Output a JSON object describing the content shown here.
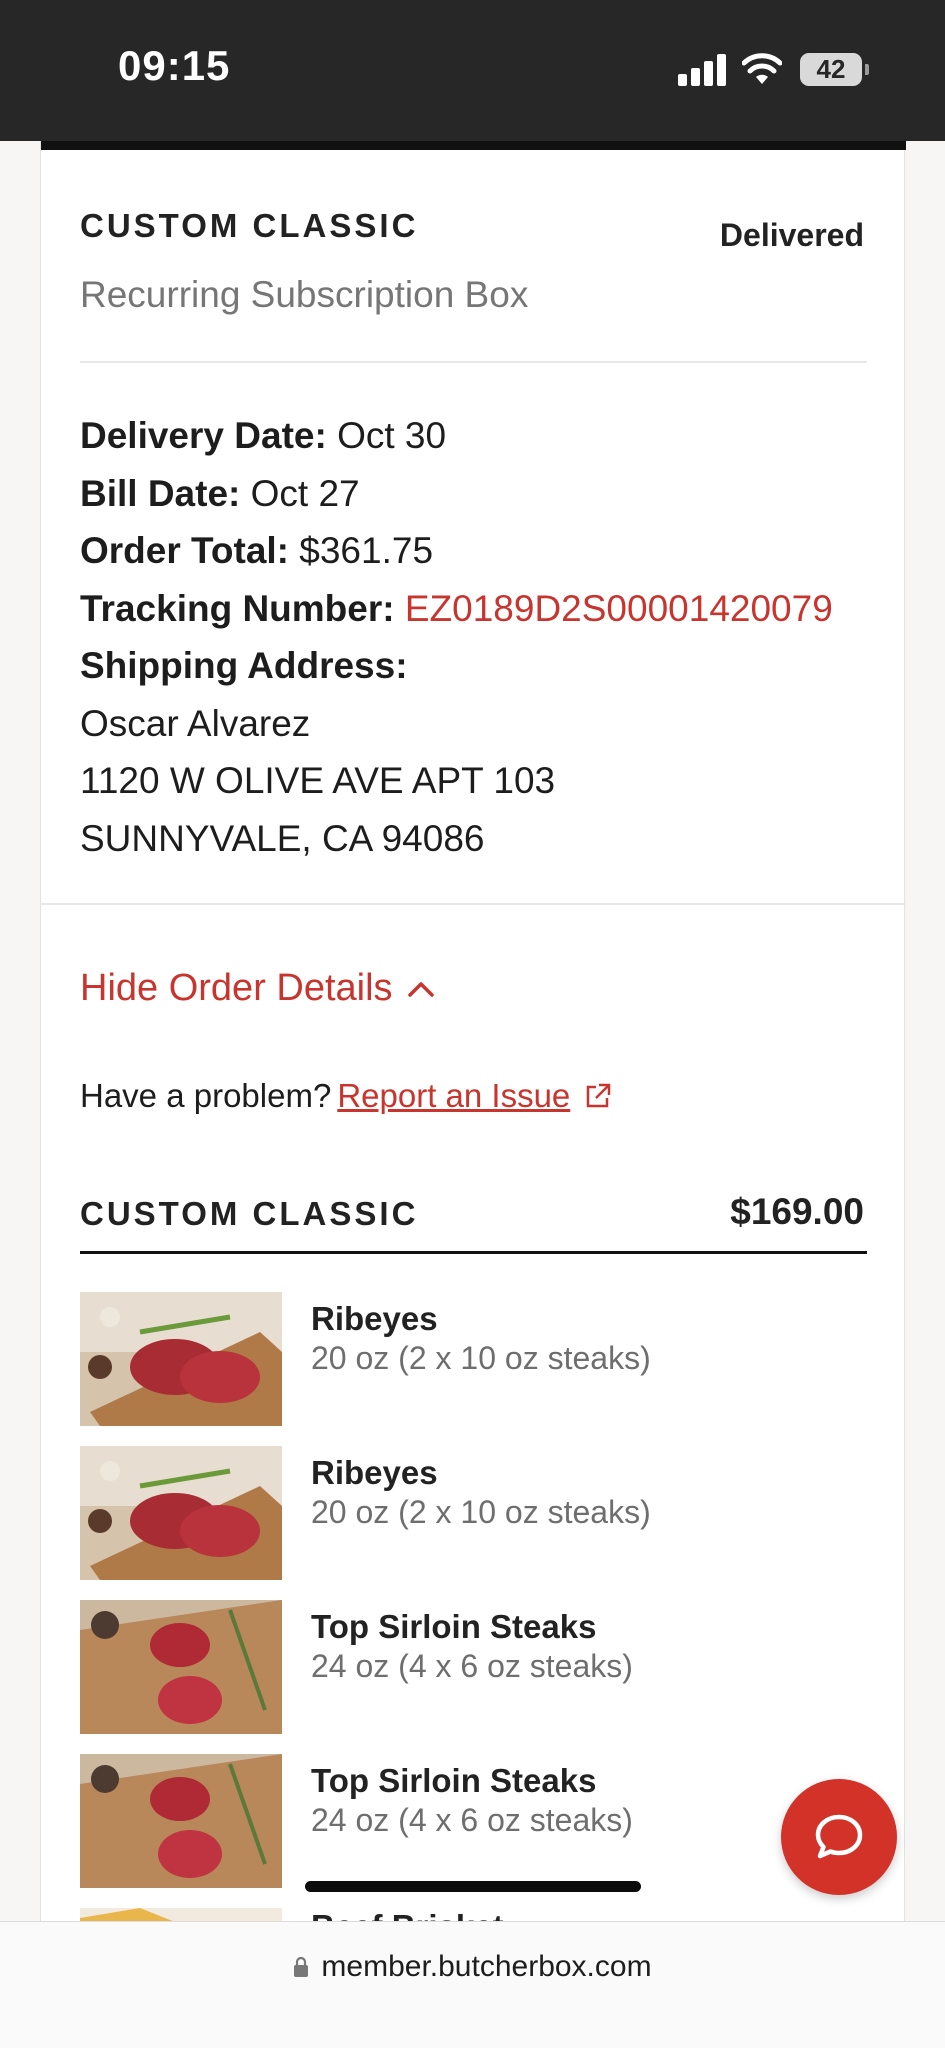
{
  "status_bar": {
    "time": "09:15",
    "battery": "42"
  },
  "order": {
    "plan_name": "CUSTOM CLASSIC",
    "status": "Delivered",
    "plan_subtitle": "Recurring Subscription Box",
    "delivery_date_label": "Delivery Date:",
    "delivery_date": "Oct 30",
    "bill_date_label": "Bill Date:",
    "bill_date": "Oct 27",
    "order_total_label": "Order Total:",
    "order_total": "$361.75",
    "tracking_label": "Tracking Number:",
    "tracking_number": "EZ0189D2S00001420079",
    "shipping_label": "Shipping Address:",
    "address_name": "Oscar Alvarez",
    "address_line1": "1120 W OLIVE AVE APT 103",
    "address_line2": "SUNNYVALE, CA 94086"
  },
  "details": {
    "hide_label": "Hide Order Details",
    "problem_text": "Have a problem?",
    "report_link": "Report an Issue"
  },
  "box": {
    "title": "CUSTOM CLASSIC",
    "price": "$169.00",
    "items": [
      {
        "name": "Ribeyes",
        "desc": "20 oz (2 x 10 oz steaks)",
        "image": "ribeye-steaks-photo"
      },
      {
        "name": "Ribeyes",
        "desc": "20 oz (2 x 10 oz steaks)",
        "image": "ribeye-steaks-photo"
      },
      {
        "name": "Top Sirloin Steaks",
        "desc": "24 oz (4 x 6 oz steaks)",
        "image": "sirloin-steaks-photo"
      },
      {
        "name": "Top Sirloin Steaks",
        "desc": "24 oz (4 x 6 oz steaks)",
        "image": "sirloin-steaks-photo"
      },
      {
        "name": "Beef Brisket",
        "desc": "",
        "image": "brisket-photo"
      }
    ]
  },
  "browser": {
    "url": "member.butcherbox.com"
  },
  "colors": {
    "accent": "#c8352e",
    "chat_button": "#d23228",
    "status_bar": "#272727"
  }
}
